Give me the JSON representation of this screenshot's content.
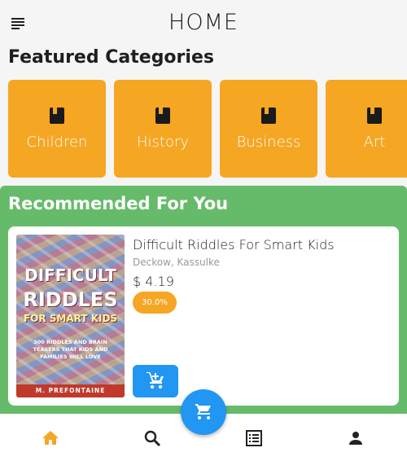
{
  "header": {
    "title": "HOME",
    "menu_icon": "menu-icon"
  },
  "featured": {
    "title": "Featured Categories",
    "categories": [
      {
        "label": "Children",
        "icon": "book-icon"
      },
      {
        "label": "History",
        "icon": "book-icon"
      },
      {
        "label": "Business",
        "icon": "book-icon"
      },
      {
        "label": "Art",
        "icon": "book-icon"
      }
    ]
  },
  "recommended": {
    "title": "Recommended For You",
    "books": [
      {
        "title": "Difficult Riddles For Smart Kids",
        "author": "Deckow, Kassulke",
        "price": "$ 4.19",
        "discount": "30.0%",
        "cover": {
          "line1": "DIFFICULT",
          "line2": "RIDDLES",
          "line3": "FOR SMART KIDS",
          "subtitle": "300 RIDDLES AND BRAIN TEASERS THAT KIDS AND FAMILIES WILL LOVE",
          "author": "M. PREFONTAINE"
        },
        "add_icon": "add-to-cart-icon"
      }
    ]
  },
  "bottom_nav": {
    "items": [
      {
        "name": "home",
        "icon": "home-icon",
        "active": true
      },
      {
        "name": "search",
        "icon": "search-icon",
        "active": false
      },
      {
        "name": "orders",
        "icon": "list-icon",
        "active": false
      },
      {
        "name": "profile",
        "icon": "person-icon",
        "active": false
      }
    ],
    "fab_icon": "shopping-cart-icon"
  },
  "colors": {
    "accent_orange": "#f5a623",
    "accent_green": "#66bb6a",
    "accent_blue": "#2196f3",
    "nav_active": "#f5a623",
    "nav_inactive": "#222222"
  }
}
